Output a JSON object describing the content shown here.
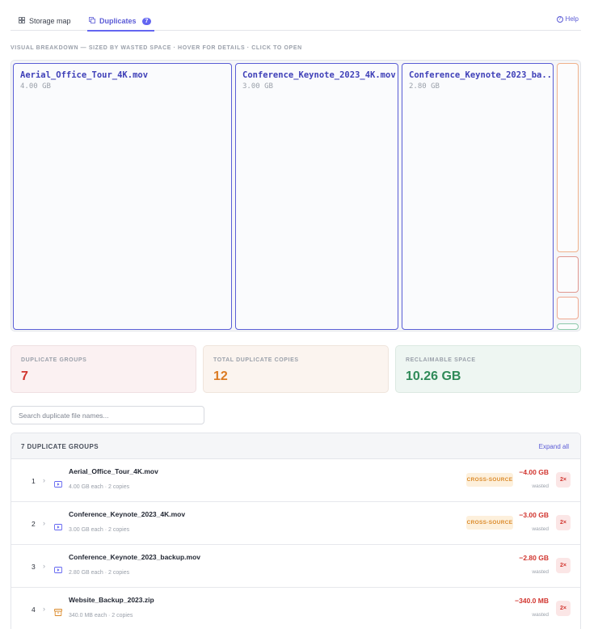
{
  "tabs": [
    {
      "label": "Storage map",
      "icon": "grid-icon"
    },
    {
      "label": "Duplicates",
      "icon": "copy-icon",
      "badge": "7"
    }
  ],
  "help": {
    "label": "Help",
    "icon": "question-circle-icon"
  },
  "caption": "VISUAL BREAKDOWN — SIZED BY WASTED SPACE · HOVER FOR DETAILS · CLICK TO OPEN",
  "treemap": {
    "tiles": [
      {
        "name": "Aerial_Office_Tour_4K.mov",
        "size": "4.00 GB"
      },
      {
        "name": "Conference_Keynote_2023_4K.mov",
        "size": "3.00 GB"
      },
      {
        "name": "Conference_Keynote_2023_ba...",
        "size": "2.80 GB"
      }
    ]
  },
  "stats": {
    "groups": {
      "label": "DUPLICATE GROUPS",
      "value": "7"
    },
    "copies": {
      "label": "TOTAL DUPLICATE COPIES",
      "value": "12"
    },
    "reclaimable": {
      "label": "RECLAIMABLE SPACE",
      "value": "10.26 GB"
    }
  },
  "search": {
    "placeholder": "Search duplicate file names..."
  },
  "groups_panel": {
    "title": "7 DUPLICATE GROUPS",
    "expand_label": "Expand all",
    "rows": [
      {
        "num": "1",
        "name": "Aerial_Office_Tour_4K.mov",
        "meta": "4.00 GB each · 2 copies",
        "badge": "CROSS-SOURCE",
        "wasted": "−4.00 GB",
        "wasted_label": "wasted",
        "mult": "2×",
        "icon": "video-icon"
      },
      {
        "num": "2",
        "name": "Conference_Keynote_2023_4K.mov",
        "meta": "3.00 GB each · 2 copies",
        "badge": "CROSS-SOURCE",
        "wasted": "−3.00 GB",
        "wasted_label": "wasted",
        "mult": "2×",
        "icon": "video-icon"
      },
      {
        "num": "3",
        "name": "Conference_Keynote_2023_backup.mov",
        "meta": "2.80 GB each · 2 copies",
        "badge": "",
        "wasted": "−2.80 GB",
        "wasted_label": "wasted",
        "mult": "2×",
        "icon": "video-icon"
      },
      {
        "num": "4",
        "name": "Website_Backup_2023.zip",
        "meta": "340.0 MB each · 2 copies",
        "badge": "",
        "wasted": "−340.0 MB",
        "wasted_label": "wasted",
        "mult": "2×",
        "icon": "archive-icon"
      }
    ]
  },
  "colors": {
    "accent": "#6366f1",
    "danger": "#d1352f",
    "warning": "#db7a22",
    "success": "#2f8a58"
  }
}
